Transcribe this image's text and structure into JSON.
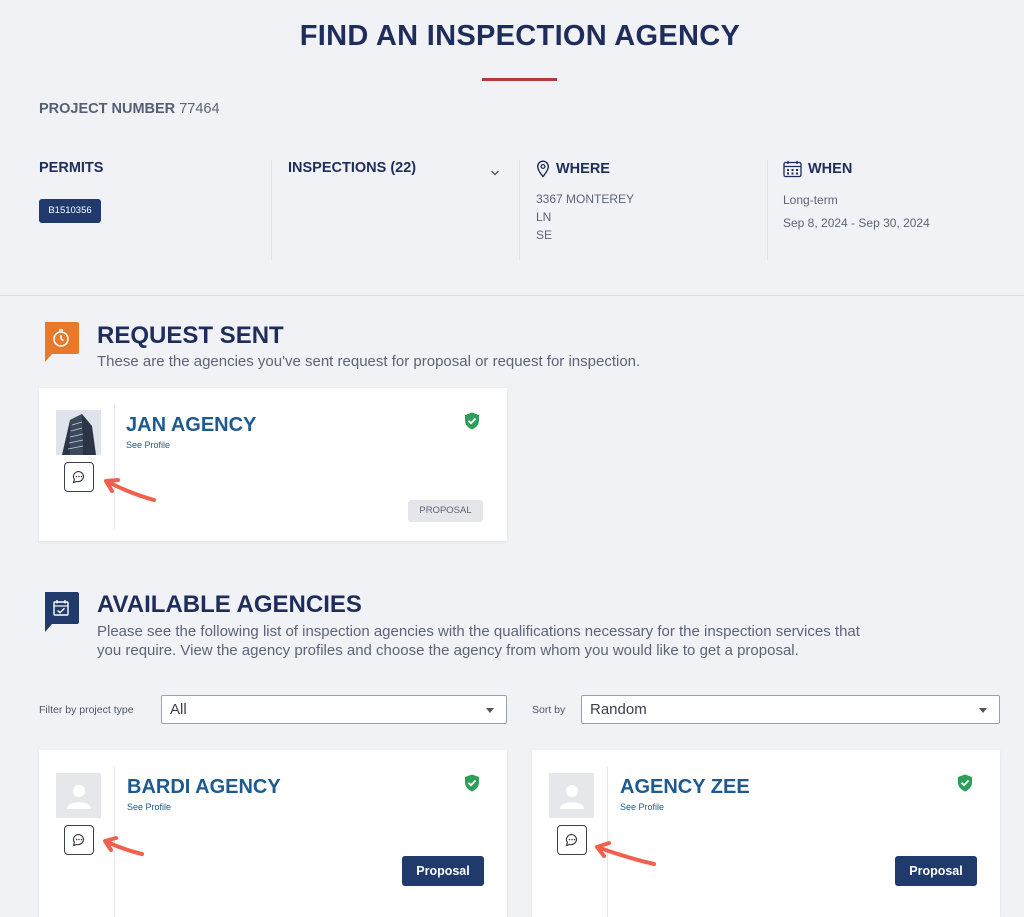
{
  "page": {
    "title": "FIND AN INSPECTION AGENCY"
  },
  "project": {
    "label": "PROJECT NUMBER",
    "number": "77464"
  },
  "permits": {
    "heading": "PERMITS",
    "badge": "B1510356"
  },
  "inspections": {
    "heading": "INSPECTIONS (22)"
  },
  "where": {
    "heading": "WHERE",
    "lines": [
      "3367 MONTEREY",
      "LN",
      "SE"
    ]
  },
  "when": {
    "heading": "WHEN",
    "term": "Long-term",
    "range": "Sep 8, 2024 - Sep 30, 2024"
  },
  "request_sent": {
    "title": "REQUEST SENT",
    "subtitle": "These are the agencies you've sent request for proposal or request for inspection.",
    "agencies": [
      {
        "name": "JAN AGENCY",
        "see_profile": "See Profile",
        "status_tag": "PROPOSAL"
      }
    ]
  },
  "available": {
    "title": "AVAILABLE AGENCIES",
    "subtitle_1": "Please see the following list of inspection agencies with the qualifications necessary for the inspection services that",
    "subtitle_2": "you require. View the agency profiles and choose the agency from whom you would like to get a proposal.",
    "filter": {
      "label": "Filter by project type",
      "value": "All"
    },
    "sort": {
      "label": "Sort by",
      "value": "Random"
    },
    "agencies": [
      {
        "name": "BARDI AGENCY",
        "see_profile": "See Profile",
        "button": "Proposal"
      },
      {
        "name": "AGENCY ZEE",
        "see_profile": "See Profile",
        "button": "Proposal"
      }
    ]
  },
  "colors": {
    "navy": "#1f2d5a",
    "button": "#1f3a6b",
    "accent_orange": "#e8792b",
    "verified_green": "#2e9e5b",
    "arrow": "#f0604d"
  }
}
